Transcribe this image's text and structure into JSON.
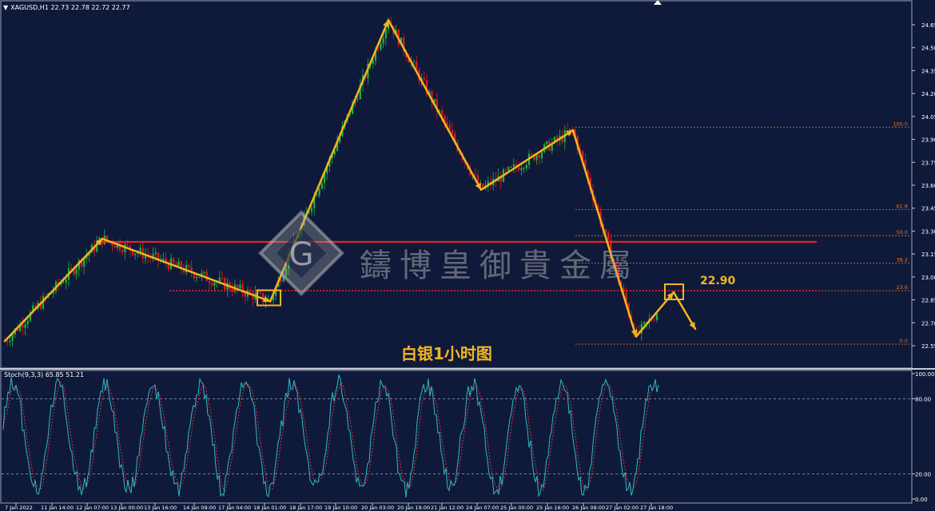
{
  "header": {
    "symbol_text": "XAGUSD,H1  22.73 22.78 22.72 22.77"
  },
  "stoch": {
    "label": "Stoch(9,3,3) 65.85 51.21"
  },
  "annotations": {
    "chart_title": "白银1小时图",
    "target_price": "22.90"
  },
  "watermark": {
    "text": "鑄博皇御貴金屬",
    "logo_letter": "G"
  },
  "colors": {
    "background": "#0f1a3a",
    "bull": "#1fb53a",
    "bear": "#e01b1b",
    "wave": "#f5b51f",
    "resistance": "#ff2020",
    "fib": "#e07820",
    "stoch_main": "#2fb8c8",
    "stoch_signal": "#e03030"
  },
  "chart_data": [
    {
      "type": "candlestick",
      "symbol": "XAGUSD",
      "timeframe": "H1",
      "ylim": [
        22.5,
        24.75
      ],
      "y_ticks": [
        "24.65",
        "24.50",
        "24.35",
        "24.20",
        "24.05",
        "23.90",
        "23.75",
        "23.60",
        "23.45",
        "23.30",
        "23.15",
        "23.00",
        "22.85",
        "22.70",
        "22.55"
      ],
      "x_ticks": [
        "7 Jan 2022",
        "11 Jan 14:00",
        "12 Jan 07:00",
        "13 Jan 00:00",
        "13 Jan 16:00",
        "14 Jan 09:00",
        "17 Jan 04:00",
        "18 Jan 01:00",
        "18 Jan 17:00",
        "19 Jan 10:00",
        "20 Jan 03:00",
        "20 Jan 19:00",
        "21 Jan 12:00",
        "24 Jan 07:00",
        "25 Jan 00:00",
        "25 Jan 16:00",
        "26 Jan 09:00",
        "27 Jan 02:00",
        "27 Jan 18:00"
      ],
      "wave_path": [
        {
          "x": "7 Jan 2022",
          "price": 22.58
        },
        {
          "x": "12 Jan 07:00",
          "price": 23.25
        },
        {
          "x": "18 Jan 01:00",
          "price": 22.84
        },
        {
          "x": "20 Jan 03:00",
          "price": 24.68
        },
        {
          "x": "24 Jan 07:00",
          "price": 23.57
        },
        {
          "x": "26 Jan 09:00",
          "price": 23.96
        },
        {
          "x": "27 Jan 02:00",
          "price": 22.61
        },
        {
          "x": "27 Jan 18:00",
          "price": 22.9
        },
        {
          "x": "27 Jan 18:00",
          "price": 22.66
        }
      ],
      "resistance": 23.23,
      "support_dotted": 22.91,
      "fibonacci": [
        {
          "label": "100.0",
          "price": 23.98
        },
        {
          "label": "61.8",
          "price": 23.44
        },
        {
          "label": "50.0",
          "price": 23.27
        },
        {
          "label": "38.2",
          "price": 23.09
        },
        {
          "label": "23.6",
          "price": 22.91
        },
        {
          "label": "0.0",
          "price": 22.56
        }
      ]
    },
    {
      "type": "line",
      "name": "Stoch(9,3,3)",
      "ylim": [
        0,
        100
      ],
      "y_ticks": [
        "100.00",
        "80.00",
        "20.00",
        "0.00"
      ],
      "levels": [
        80,
        20
      ],
      "main_last": 65.85,
      "signal_last": 51.21
    }
  ]
}
